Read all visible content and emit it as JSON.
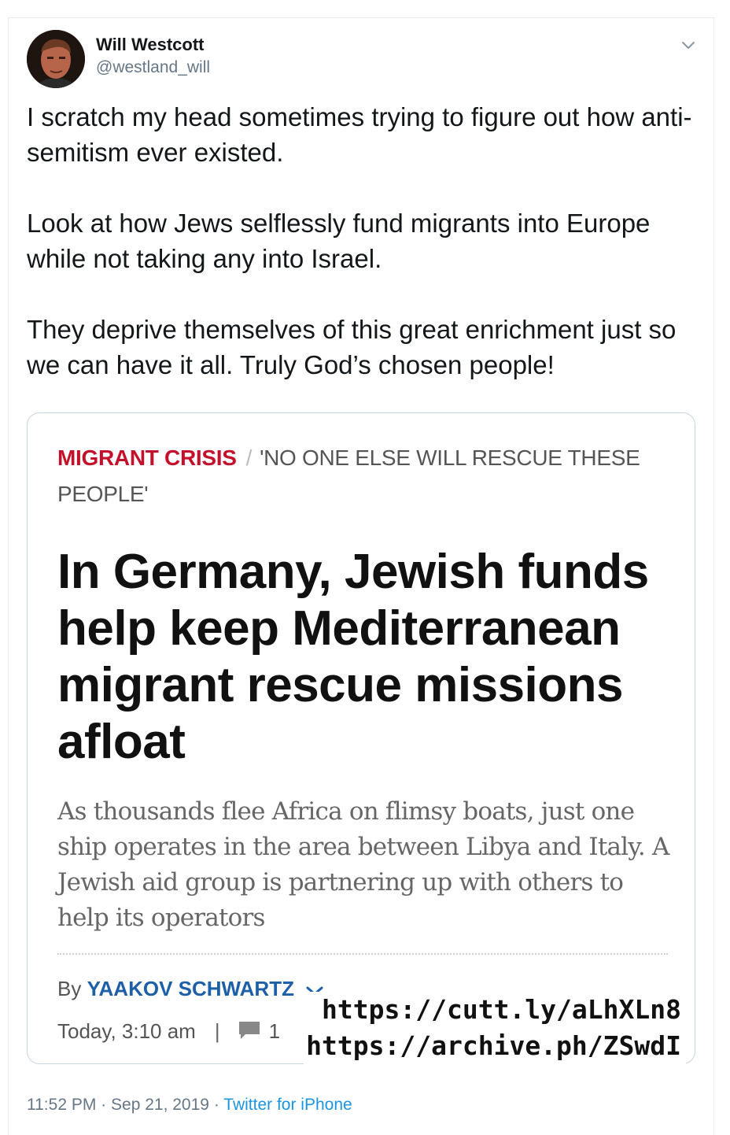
{
  "author": {
    "name": "Will Westcott",
    "handle": "@westland_will"
  },
  "tweet": {
    "text": "I scratch my head sometimes trying to figure out how anti-semitism ever existed.\n\nLook at how Jews selflessly fund migrants into Europe while not taking any into Israel.\n\nThey deprive themselves of this great enrichment just so we can have it all. Truly God’s chosen people!"
  },
  "card": {
    "section": "MIGRANT CRISIS",
    "separator": "/",
    "kicker": "'NO ONE ELSE WILL RESCUE THESE PEOPLE'",
    "headline": "In Germany, Jewish funds help keep Mediterranean migrant rescue missions afloat",
    "dek": "As thousands flee Africa on flimsy boats, just one ship operates in the area between Libya and Italy. A Jewish aid group is partnering up with others to help its operators",
    "byline_prefix": "By",
    "byline_author": "YAAKOV SCHWARTZ",
    "date": "Today, 3:10 am",
    "pipe": "|",
    "comments": "1"
  },
  "overlay_urls": [
    "https://cutt.ly/aLhXLn8",
    "https://archive.ph/ZSwdI"
  ],
  "footer": {
    "time": "11:52 PM",
    "dot": "·",
    "date": "Sep 21, 2019",
    "source": "Twitter for iPhone"
  },
  "icons": {
    "caret": "chevron-down-icon",
    "comment": "comment-icon"
  },
  "colors": {
    "section_red": "#c4112b",
    "byline_blue": "#1d5fa8",
    "twitter_blue": "#1b95e0",
    "muted_gray": "#657786"
  }
}
